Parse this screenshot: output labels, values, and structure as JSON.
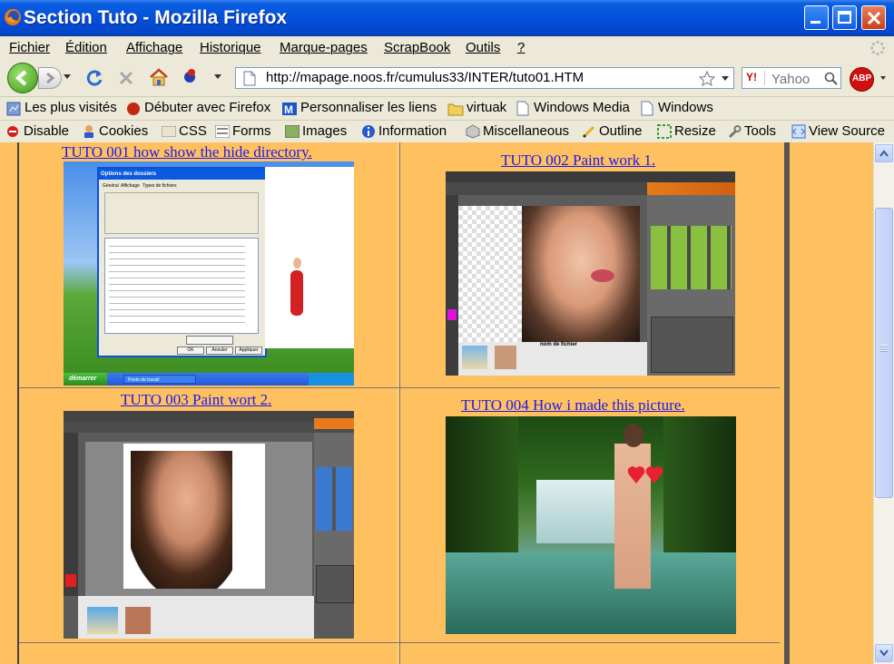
{
  "window": {
    "title": "Section Tuto - Mozilla Firefox"
  },
  "menubar": {
    "items": [
      "Fichier",
      "Édition",
      "Affichage",
      "Historique",
      "Marque-pages",
      "ScrapBook",
      "Outils",
      "?"
    ]
  },
  "navbar": {
    "url": "http://mapage.noos.fr/cumulus33/INTER/tuto01.HTM",
    "search_placeholder": "Yahoo",
    "icons": [
      "back-icon",
      "forward-icon",
      "reload-icon",
      "stop-icon",
      "home-icon",
      "addon-icon",
      "bookmark-star-icon",
      "adblock-icon"
    ]
  },
  "bookmarks": {
    "items": [
      "Les plus visités",
      "Débuter avec Firefox",
      "Personnaliser les liens",
      "virtuak",
      "Windows Media",
      "Windows"
    ]
  },
  "devtoolbar": {
    "items": [
      "Disable",
      "Cookies",
      "CSS",
      "Forms",
      "Images",
      "Information",
      "Miscellaneous",
      "Outline",
      "Resize",
      "Tools",
      "View Source"
    ]
  },
  "page": {
    "tutorials": [
      {
        "label": "TUTO 001 how show the hide directory."
      },
      {
        "label": "TUTO 002 Paint work 1."
      },
      {
        "label": "TUTO 003 Paint wort 2."
      },
      {
        "label": "TUTO 004 How i made this picture."
      }
    ],
    "thumb1": {
      "dialog_title": "Options des dossiers",
      "tabs": [
        "Général",
        "Affichage",
        "Types de fichiers"
      ],
      "ok": "OK",
      "cancel": "Annuler",
      "apply": "Appliquer",
      "start": "démarrer",
      "desktop_item": "Poste de travail"
    },
    "thumb2": {
      "file_label": "nom de fichier"
    }
  },
  "colors": {
    "content_bg": "#ffc060",
    "link": "#1a1aee",
    "titlebar": "#0550dc"
  }
}
